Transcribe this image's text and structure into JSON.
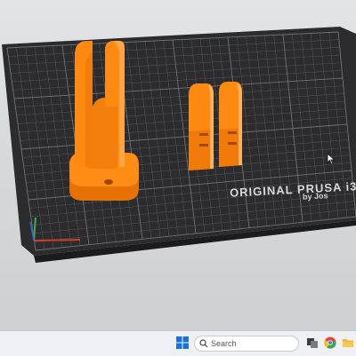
{
  "bed": {
    "brand": "ORIGINAL PRUSA i3",
    "brand_sub": "by Jos"
  },
  "taskbar": {
    "search_label": "Search",
    "icons": [
      "windows-start-icon",
      "search-icon",
      "task-view-icon",
      "chrome-icon",
      "folder-icon"
    ]
  },
  "colors": {
    "model": "#ff8a12",
    "bed": "#2d2d2f",
    "grid": "#78797c",
    "background": "#dcdddf"
  }
}
